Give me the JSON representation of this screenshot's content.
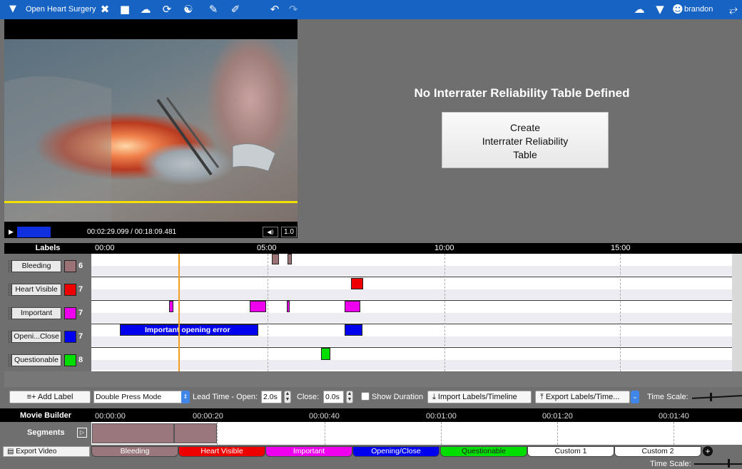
{
  "app": {
    "title": "Open Heart Surgery",
    "user": "brandon"
  },
  "video": {
    "timecode": "00:02:29.099 / 00:18:09.481",
    "speed": "1.0",
    "progress": 0.137
  },
  "irr": {
    "title": "No Interrater Reliability Table Defined",
    "button": "Create\nInterrater Reliability\nTable"
  },
  "timeline": {
    "header": "Labels",
    "ticks": [
      "00:00",
      "05:00",
      "10:00",
      "15:00"
    ],
    "rows": [
      {
        "label": "Bleeding",
        "color": "#9b7276",
        "count": "6"
      },
      {
        "label": "Heart Visible",
        "color": "#ee0000",
        "count": "7"
      },
      {
        "label": "Important",
        "color": "#ee00ee",
        "count": "7"
      },
      {
        "label": "Openi...Close",
        "color": "#0000ee",
        "count": "7"
      },
      {
        "label": "Questionable",
        "color": "#00dd00",
        "count": "8"
      }
    ],
    "annotation": "Important opening error"
  },
  "toolbar": {
    "add_label": "Add Label",
    "mode": "Double Press Mode",
    "lead_open_label": "Lead Time - Open:",
    "lead_open_value": "2.0s",
    "close_label": "Close:",
    "close_value": "0.0s",
    "show_duration": "Show Duration",
    "import": "Import Labels/Timeline",
    "export": "Export Labels/Time...",
    "time_scale": "Time Scale:"
  },
  "movie_builder": {
    "title": "Movie Builder",
    "ticks": [
      "00:00:00",
      "00:00:20",
      "00:00:40",
      "00:01:00",
      "00:01:20",
      "00:01:40"
    ],
    "segments_label": "Segments",
    "export_video": "Export Video",
    "categories": [
      {
        "label": "Bleeding",
        "color": "#99777c",
        "text": "#ffffff"
      },
      {
        "label": "Heart Visible",
        "color": "#ee0000",
        "text": "#ffffff"
      },
      {
        "label": "Important",
        "color": "#ee00ee",
        "text": "#ffffff"
      },
      {
        "label": "Opening/Close",
        "color": "#0000ee",
        "text": "#ffffff"
      },
      {
        "label": "Questionable",
        "color": "#00dd00",
        "text": "#222222"
      },
      {
        "label": "Custom 1",
        "color": "#ffffff",
        "text": "#111111"
      },
      {
        "label": "Custom 2",
        "color": "#ffffff",
        "text": "#111111"
      }
    ],
    "time_scale": "Time Scale:"
  }
}
